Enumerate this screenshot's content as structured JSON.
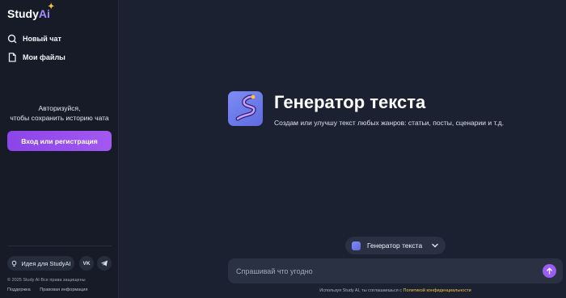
{
  "brand": {
    "name": "Study",
    "ai": "Ai"
  },
  "sidebar": {
    "nav": [
      {
        "label": "Новый чат",
        "icon": "search-icon"
      },
      {
        "label": "Мои файлы",
        "icon": "file-icon"
      }
    ],
    "auth_line1": "Авторизуйся,",
    "auth_line2": "чтобы сохранить историю чата",
    "auth_button": "Вход или регистрация",
    "idea_button": "Идея для StudyAI",
    "vk_label": "VK",
    "copyright": "© 2025 Study AI Все права защищены",
    "links": [
      "Поддержка",
      "Правовая информация"
    ]
  },
  "main": {
    "title": "Генератор текста",
    "subtitle": "Создам или улучшу текст любых жанров: статьи, посты, сценарии и т.д.",
    "model_select": "Генератор текста",
    "prompt_placeholder": "Спрашивай что угодно",
    "disclaimer_prefix": "Используя Study AI, ты соглашаешься с",
    "disclaimer_link": "Политикой конфиденциальности"
  },
  "colors": {
    "accent": "#9b5cf2",
    "background": "#1b2130",
    "sidebar": "#161b27",
    "link": "#f5c542"
  }
}
